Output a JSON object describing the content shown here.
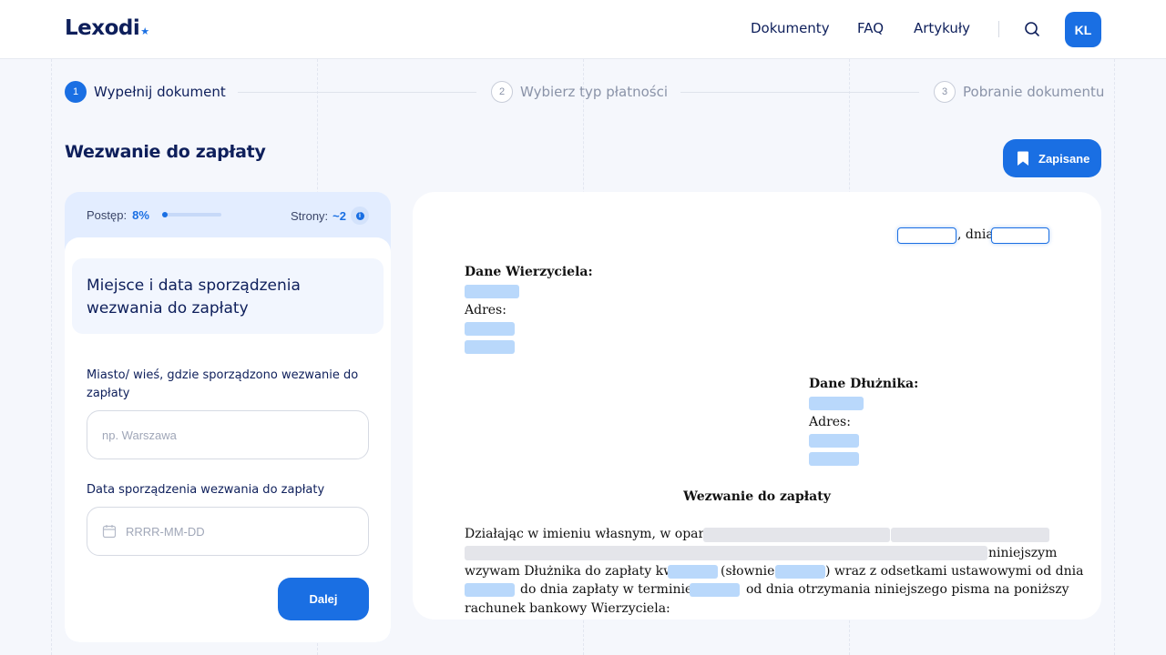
{
  "header": {
    "logo": "Lexodi",
    "nav": [
      "Dokumenty",
      "FAQ",
      "Artykuły"
    ],
    "avatar_initials": "KL"
  },
  "stepper": {
    "steps": [
      {
        "number": "1",
        "label": "Wypełnij dokument"
      },
      {
        "number": "2",
        "label": "Wybierz typ płatności"
      },
      {
        "number": "3",
        "label": "Pobranie dokumentu"
      }
    ],
    "active_step": 1
  },
  "page": {
    "title": "Wezwanie do zapłaty",
    "saved_label": "Zapisane"
  },
  "form": {
    "progress_label": "Postęp:",
    "progress_value": "8%",
    "progress_fraction": 0.08,
    "pages_label": "Strony:",
    "pages_value": "~2",
    "section_title": "Miejsce i data sporządzenia wezwania do zapłaty",
    "city_label": "Miasto/ wieś, gdzie sporządzono wezwanie do zapłaty",
    "city_placeholder": "np. Warszawa",
    "date_label": "Data sporządzenia wezwania do zapłaty",
    "date_placeholder": "RRRR-MM-DD",
    "next_label": "Dalej"
  },
  "document": {
    "date_sep": ", dnia",
    "creditor_heading": "Dane Wierzyciela:",
    "creditor_address": "Adres:",
    "debtor_heading": "Dane Dłużnika:",
    "debtor_address": "Adres:",
    "title": "Wezwanie do zapłaty",
    "p1_start": "Działając w imieniu własnym, w oparciu o",
    "p1_line2_end": "niniejszym",
    "p1_line3_a": "wzywam Dłużnika do zapłaty kwoty",
    "p1_line3_b": "(słownie:",
    "p1_line3_c": ") wraz z odsetkami ustawowymi od dnia",
    "p1_line4_a": "do dnia zapłaty w terminie",
    "p1_line4_b": "od dnia otrzymania niniejszego pisma na poniższy",
    "p1_line5": "rachunek bankowy Wierzyciela:"
  },
  "colors": {
    "accent": "#1a6fe3",
    "navy": "#0e1f5b",
    "placeholder_blue": "#b9d8fb",
    "placeholder_grey": "#e4e5ea"
  }
}
